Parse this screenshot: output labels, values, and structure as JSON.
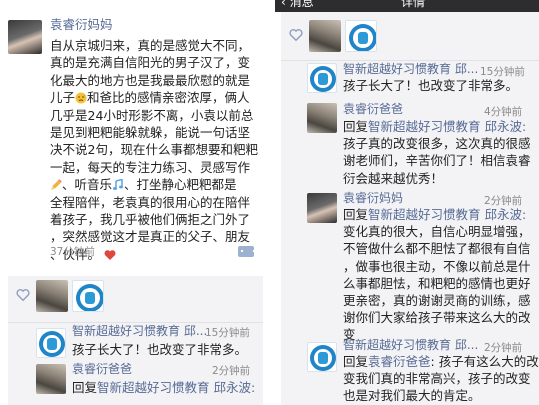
{
  "nav": {
    "back_label": "消息",
    "title": "详情"
  },
  "post": {
    "author": "袁睿衍妈妈",
    "lines": [
      "自从京城归来，真的是感觉大不同，",
      "真的是充满自信阳光的男子汉了，变",
      "化最大的地方也是我最最欣慰的就是",
      "儿子",
      "和爸比的感情亲密浓厚，俩人",
      "几乎是24小时形影不离，小袁以前总",
      "是见到粑粑能躲就躲，能说一句话坚",
      "决不说2句，现在什么事都想要和粑粑",
      "一起，每天的专注力练习、灵感写作",
      "、听音乐",
      "、打坐静心粑粑都是",
      "全程陪伴，老袁真的很用心的在陪伴",
      "着孩子，我几乎被他们俩拒之门外了",
      "，突然感觉这才是真正的父子、朋友",
      "、伙伴。"
    ],
    "time": "37分钟前"
  },
  "comments_left": [
    {
      "author": "智新超越好习惯教育 邱...",
      "time": "15分钟前",
      "text": [
        "孩子长大了！也改变了非常多。"
      ]
    },
    {
      "author": "袁睿衍爸爸",
      "time": "2分钟前",
      "reply_prefix": "回复",
      "reply_to": "智新超越好习惯教育 邱永波:"
    }
  ],
  "comments_right": [
    {
      "author": "智新超越好习惯教育 邱...",
      "time": "15分钟前",
      "text": [
        "孩子长大了！也改变了非常多。"
      ]
    },
    {
      "author": "袁睿衍爸爸",
      "time": "4分钟前",
      "reply_prefix": "回复",
      "reply_to": "智新超越好习惯教育 邱永波:",
      "text": [
        "孩子真的改变很多，这次真的很感",
        "谢老师们，辛苦你们了！相信袁睿",
        "衍会越来越优秀！"
      ]
    },
    {
      "author": "袁睿衍妈妈",
      "time": "2分钟前",
      "reply_prefix": "回复",
      "reply_to": "智新超越好习惯教育 邱永波:",
      "text": [
        "变化真的很大，自信心明显增强，",
        "不管做什么都不胆怯了都很有自信",
        "，做事也很主动，不像以前总是什",
        "么事都胆怯，和粑粑的感情也更好",
        "更亲密，真的谢谢灵商的训练，感",
        "谢你们大家给孩子带来这么大的改",
        "变"
      ]
    },
    {
      "author": "智新超越好习惯教育 邱...",
      "time": "2分钟前",
      "reply_prefix": "回复",
      "reply_to": "袁睿衍爸爸",
      "text_first": ": 孩子有这么大的改",
      "text": [
        "变我们真的非常高兴，孩子的改变",
        "也是对我们最大的肯定。"
      ]
    }
  ],
  "colors": {
    "link": "#576b95",
    "nav": "#2d2d30",
    "likes_bg": "#f3f3f5",
    "heart": "#e0463a"
  },
  "icons": [
    "heart-icon",
    "comment-icon",
    "emoji-sweat",
    "emoji-pencil",
    "emoji-music",
    "emoji-heart"
  ]
}
